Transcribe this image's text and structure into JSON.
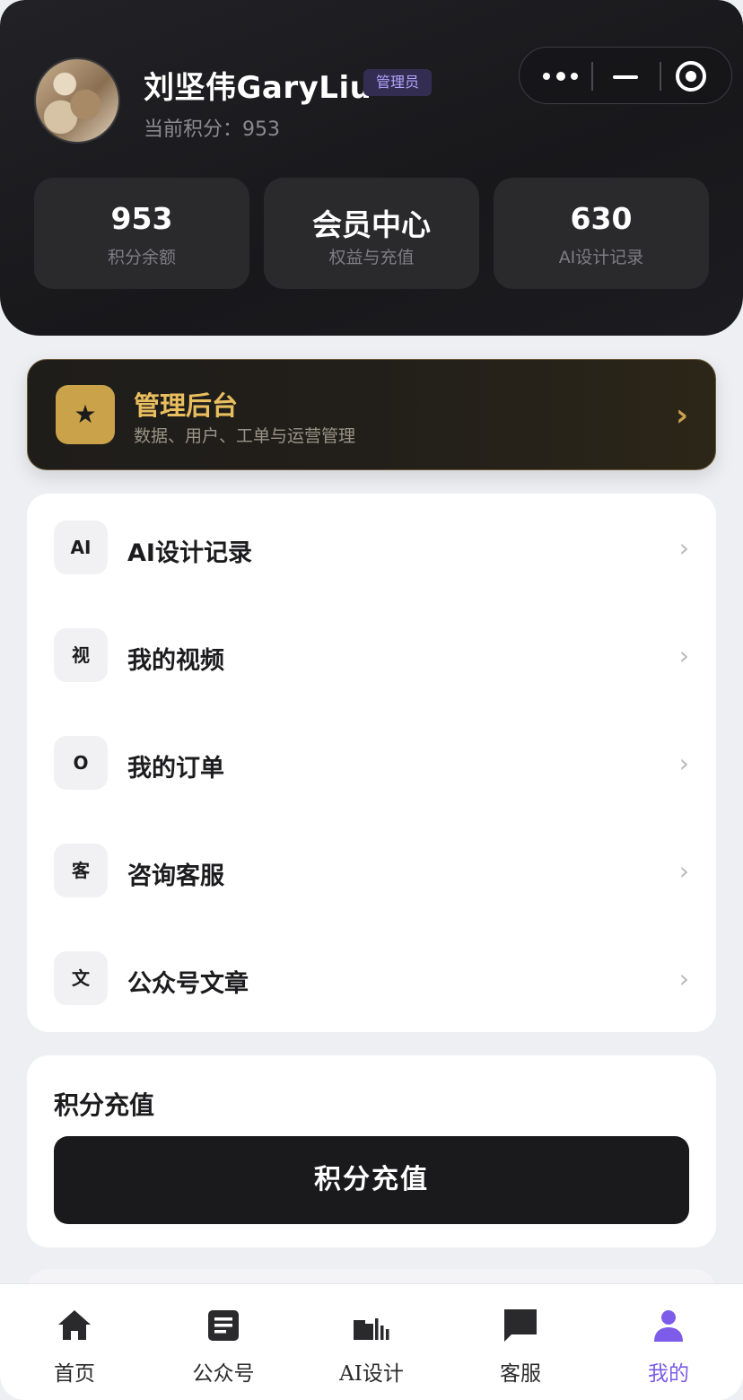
{
  "header": {
    "user_name": "刘坚伟GaryLiu",
    "role_badge": "管理员",
    "points_line": "当前积分：953",
    "stats": [
      {
        "value": "953",
        "label": "积分余额"
      },
      {
        "value": "会员中心",
        "label": "权益与充值"
      },
      {
        "value": "630",
        "label": "AI设计记录"
      }
    ]
  },
  "capsule": {
    "more_icon": "more-dots-icon",
    "minimize_icon": "minimize-icon",
    "close_icon": "target-close-icon"
  },
  "admin": {
    "icon": "★",
    "title": "管理后台",
    "subtitle": "数据、用户、工单与运营管理",
    "chevron": "›"
  },
  "menu": {
    "items": [
      {
        "icon_text": "AI",
        "label": "AI设计记录",
        "chevron": "›"
      },
      {
        "icon_text": "视",
        "label": "我的视频",
        "chevron": "›"
      },
      {
        "icon_text": "O",
        "label": "我的订单",
        "chevron": "›"
      },
      {
        "icon_text": "客",
        "label": "咨询客服",
        "chevron": "›"
      },
      {
        "icon_text": "文",
        "label": "公众号文章",
        "chevron": "›"
      }
    ]
  },
  "recharge": {
    "heading": "积分充值",
    "button": "积分充值"
  },
  "tabbar": {
    "items": [
      {
        "label": "首页",
        "icon": "home-icon"
      },
      {
        "label": "公众号",
        "icon": "article-icon"
      },
      {
        "label": "AI设计",
        "icon": "design-chart-icon"
      },
      {
        "label": "客服",
        "icon": "chat-icon"
      },
      {
        "label": "我的",
        "icon": "user-icon",
        "active": true
      }
    ]
  },
  "colors": {
    "accent": "#7c5ce8",
    "gold": "#e9be5f",
    "dark": "#1a1a1c"
  }
}
